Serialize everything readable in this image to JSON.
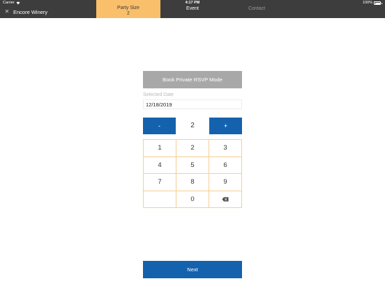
{
  "status_bar": {
    "carrier": "Carrier",
    "time": "4:17 PM",
    "battery": "100%"
  },
  "header": {
    "app_title": "Encore Winery",
    "close_icon": "close-icon",
    "tabs": [
      {
        "label": "Party Size",
        "value": "2",
        "active": true
      },
      {
        "label": "Event",
        "active": false
      },
      {
        "label": "Contact",
        "active": false
      }
    ]
  },
  "main": {
    "book_private_label": "Book Private RSVP Mode",
    "selected_date_label": "Selected Date",
    "selected_date_value": "12/18/2019",
    "stepper": {
      "minus_label": "-",
      "value": "2",
      "plus_label": "+"
    },
    "keypad": {
      "keys": [
        "1",
        "2",
        "3",
        "4",
        "5",
        "6",
        "7",
        "8",
        "9",
        "",
        "0"
      ],
      "backspace_icon": "backspace-icon"
    },
    "next_label": "Next"
  },
  "colors": {
    "header_bg": "#3d3d3d",
    "active_tab": "#f9bf6a",
    "primary_blue": "#1462ad",
    "disabled_gray": "#a8a8a8",
    "keypad_border": "#f6cf8f"
  }
}
